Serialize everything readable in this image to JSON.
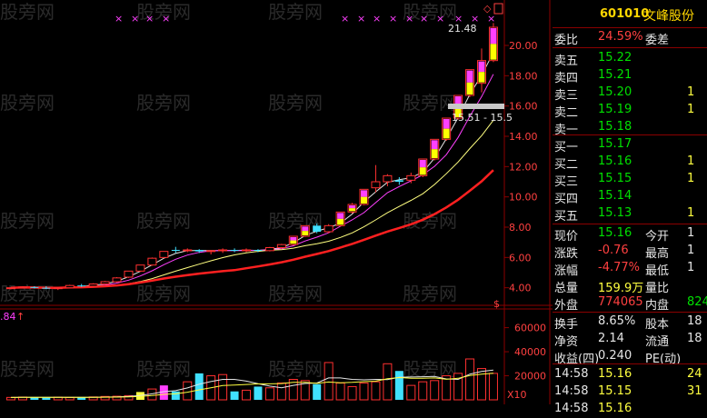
{
  "stock": {
    "code": "601010",
    "name": "文峰股份"
  },
  "chart": {
    "price_ticks": [
      "20.00",
      "18.00",
      "16.00",
      "14.00",
      "12.00",
      "10.00",
      "8.00",
      "6.00",
      "4.00"
    ],
    "vol_ticks": [
      "60000",
      "40000",
      "20000"
    ],
    "high_label": "21.48",
    "mark_label": "15.51 - 15.5",
    "vol_label": "X10",
    "indicator_label": ".84",
    "s_mark": "$",
    "watermark": "股旁网"
  },
  "chart_data": {
    "type": "candlestick",
    "ylim": [
      3.2,
      21.8
    ],
    "candles": [
      [
        4.0,
        4.05,
        3.9,
        4.0
      ],
      [
        4.0,
        4.1,
        3.95,
        4.05
      ],
      [
        4.05,
        4.1,
        3.95,
        4.0
      ],
      [
        4.0,
        4.1,
        3.9,
        3.95
      ],
      [
        3.95,
        4.05,
        3.85,
        4.0
      ],
      [
        4.0,
        4.2,
        3.95,
        4.15
      ],
      [
        4.15,
        4.25,
        4.05,
        4.1
      ],
      [
        4.1,
        4.3,
        4.05,
        4.25
      ],
      [
        4.25,
        4.45,
        4.2,
        4.4
      ],
      [
        4.4,
        4.7,
        4.35,
        4.65
      ],
      [
        4.7,
        5.1,
        4.65,
        5.1
      ],
      [
        5.1,
        5.5,
        5.05,
        5.5
      ],
      [
        5.5,
        6.0,
        5.45,
        5.95
      ],
      [
        6.0,
        6.4,
        5.95,
        6.4
      ],
      [
        6.5,
        6.7,
        6.3,
        6.45
      ],
      [
        6.45,
        6.6,
        6.35,
        6.5
      ],
      [
        6.5,
        6.55,
        6.3,
        6.4
      ],
      [
        6.4,
        6.5,
        6.2,
        6.45
      ],
      [
        6.45,
        6.6,
        6.3,
        6.5
      ],
      [
        6.5,
        6.6,
        6.35,
        6.45
      ],
      [
        6.45,
        6.6,
        6.35,
        6.5
      ],
      [
        6.5,
        6.55,
        6.35,
        6.45
      ],
      [
        6.45,
        6.7,
        6.4,
        6.65
      ],
      [
        6.65,
        6.9,
        6.55,
        6.85
      ],
      [
        6.85,
        7.4,
        6.8,
        7.4
      ],
      [
        7.4,
        8.1,
        7.35,
        8.1
      ],
      [
        8.1,
        8.25,
        7.6,
        7.7
      ],
      [
        7.7,
        8.2,
        7.6,
        8.1
      ],
      [
        8.1,
        9.0,
        8.05,
        9.0
      ],
      [
        9.0,
        9.6,
        8.9,
        9.5
      ],
      [
        9.5,
        10.5,
        9.45,
        10.5
      ],
      [
        10.6,
        12.1,
        10.3,
        11.0
      ],
      [
        11.0,
        11.5,
        10.7,
        11.4
      ],
      [
        11.1,
        11.3,
        10.8,
        11.0
      ],
      [
        11.1,
        11.6,
        10.9,
        11.4
      ],
      [
        11.4,
        12.5,
        11.3,
        12.5
      ],
      [
        12.5,
        13.8,
        12.4,
        13.8
      ],
      [
        13.8,
        15.2,
        13.7,
        15.2
      ],
      [
        15.2,
        16.7,
        15.1,
        16.7
      ],
      [
        16.7,
        18.4,
        16.6,
        18.4
      ],
      [
        17.5,
        19.8,
        16.9,
        19.0
      ],
      [
        19.0,
        21.48,
        18.9,
        21.2
      ]
    ],
    "volumes": [
      2000,
      2300,
      2100,
      1800,
      2200,
      1900,
      2100,
      2400,
      2800,
      3000,
      3500,
      6500,
      9000,
      12000,
      7000,
      15000,
      22000,
      20000,
      21000,
      7000,
      8000,
      11000,
      10000,
      14000,
      17000,
      16000,
      13000,
      31000,
      14000,
      11000,
      14000,
      15000,
      30000,
      24000,
      12000,
      15000,
      16000,
      20000,
      22000,
      34000,
      26000,
      22000
    ],
    "vol_ylim": [
      0,
      68000
    ]
  },
  "quote": {
    "weibi_label": "委比",
    "weibi_value": "24.59%",
    "weicha_label": "委差",
    "sell": [
      {
        "label": "卖五",
        "price": "15.22"
      },
      {
        "label": "卖四",
        "price": "15.21"
      },
      {
        "label": "卖三",
        "price": "15.20",
        "vol": "1"
      },
      {
        "label": "卖二",
        "price": "15.19",
        "vol": "1"
      },
      {
        "label": "卖一",
        "price": "15.18"
      }
    ],
    "buy": [
      {
        "label": "买一",
        "price": "15.17"
      },
      {
        "label": "买二",
        "price": "15.16",
        "vol": "1"
      },
      {
        "label": "买三",
        "price": "15.15",
        "vol": "1"
      },
      {
        "label": "买四",
        "price": "15.14"
      },
      {
        "label": "买五",
        "price": "15.13",
        "vol": "1"
      }
    ],
    "stats": [
      {
        "l1": "现价",
        "v1": "15.16",
        "l2": "今开",
        "v2": "1"
      },
      {
        "l1": "涨跌",
        "v1": "-0.76",
        "l2": "最高",
        "v2": "1"
      },
      {
        "l1": "涨幅",
        "v1": "-4.77%",
        "l2": "最低",
        "v2": "1"
      },
      {
        "l1": "总量",
        "v1": "159.9万",
        "l2": "量比",
        "v2": ""
      },
      {
        "l1": "外盘",
        "v1": "774065",
        "l2": "内盘",
        "v2": "824"
      }
    ],
    "fin": [
      {
        "l1": "换手",
        "v1": "8.65%",
        "l2": "股本",
        "v2": "18"
      },
      {
        "l1": "净资",
        "v1": "2.14",
        "l2": "流通",
        "v2": "18"
      },
      {
        "l1": "收益(四)",
        "v1": "0.240",
        "l2": "PE(动)",
        "v2": ""
      }
    ],
    "ticks": [
      {
        "time": "14:58",
        "price": "15.16",
        "vol": "24"
      },
      {
        "time": "14:58",
        "price": "15.15",
        "vol": "31"
      },
      {
        "time": "14:58",
        "price": "15.16",
        "vol": ""
      }
    ]
  }
}
